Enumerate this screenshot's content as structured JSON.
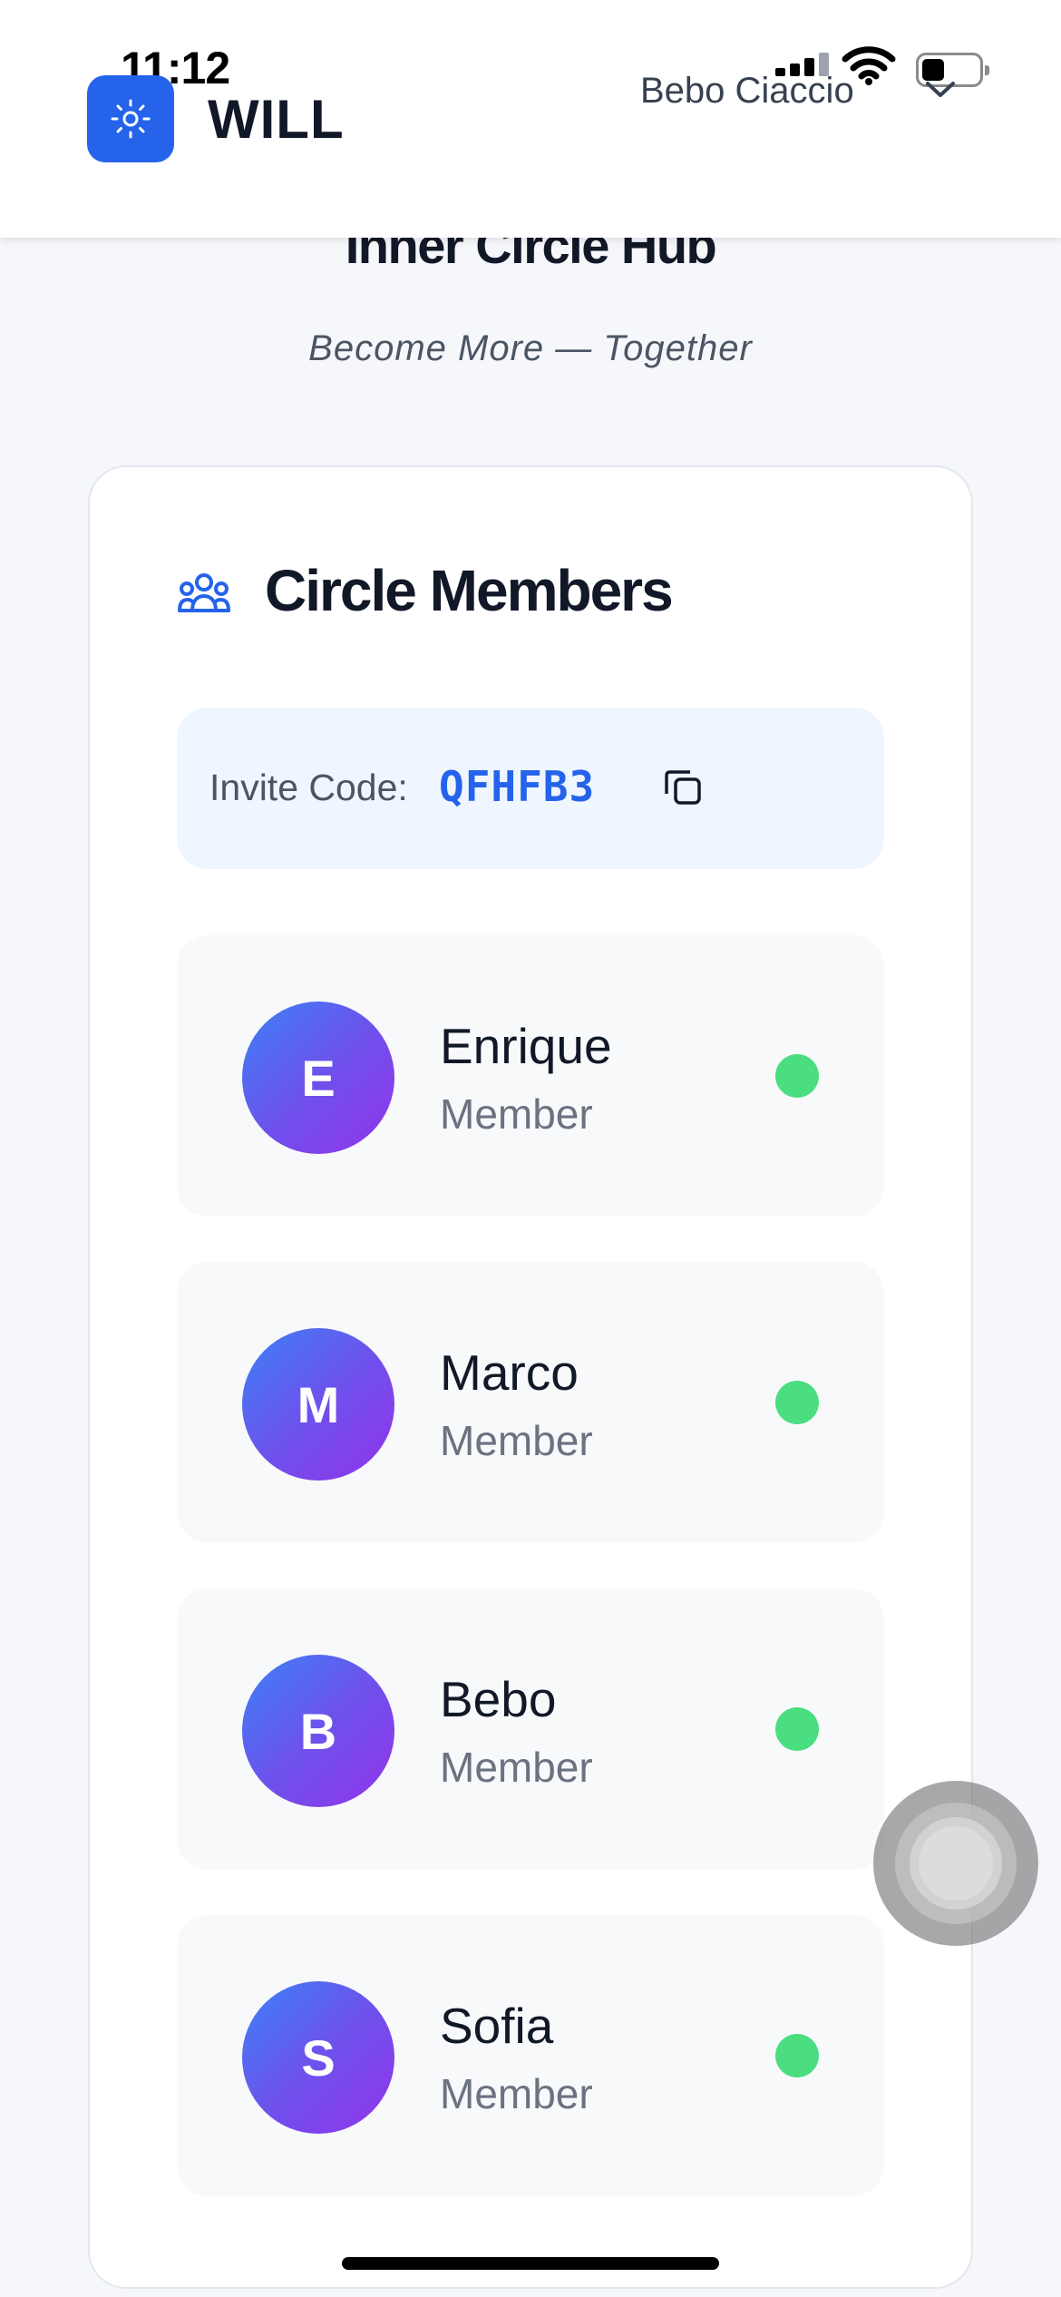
{
  "status_bar": {
    "time": "11:12",
    "icons": [
      "cellular-signal-icon",
      "wifi-icon",
      "battery-icon"
    ]
  },
  "header": {
    "logo_icon": "sun-icon",
    "app_name": "WILL",
    "user_name": "Bebo Ciaccio",
    "menu_icon": "chevron-down-icon"
  },
  "page": {
    "title": "Inner Circle Hub",
    "subtitle": "Become More — Together"
  },
  "circle_card": {
    "icon": "users-group-icon",
    "title": "Circle Members",
    "invite": {
      "label": "Invite Code:",
      "code": "QFHFB3",
      "copy_icon": "copy-icon"
    },
    "members": [
      {
        "initial": "E",
        "name": "Enrique",
        "role": "Member",
        "status": "online"
      },
      {
        "initial": "M",
        "name": "Marco",
        "role": "Member",
        "status": "online"
      },
      {
        "initial": "B",
        "name": "Bebo",
        "role": "Member",
        "status": "online"
      },
      {
        "initial": "S",
        "name": "Sofia",
        "role": "Member",
        "status": "online"
      }
    ]
  },
  "colors": {
    "accent": "#2563eb",
    "online": "#4ade80",
    "avatar_gradient_start": "#3b82f6",
    "avatar_gradient_end": "#9333ea"
  }
}
